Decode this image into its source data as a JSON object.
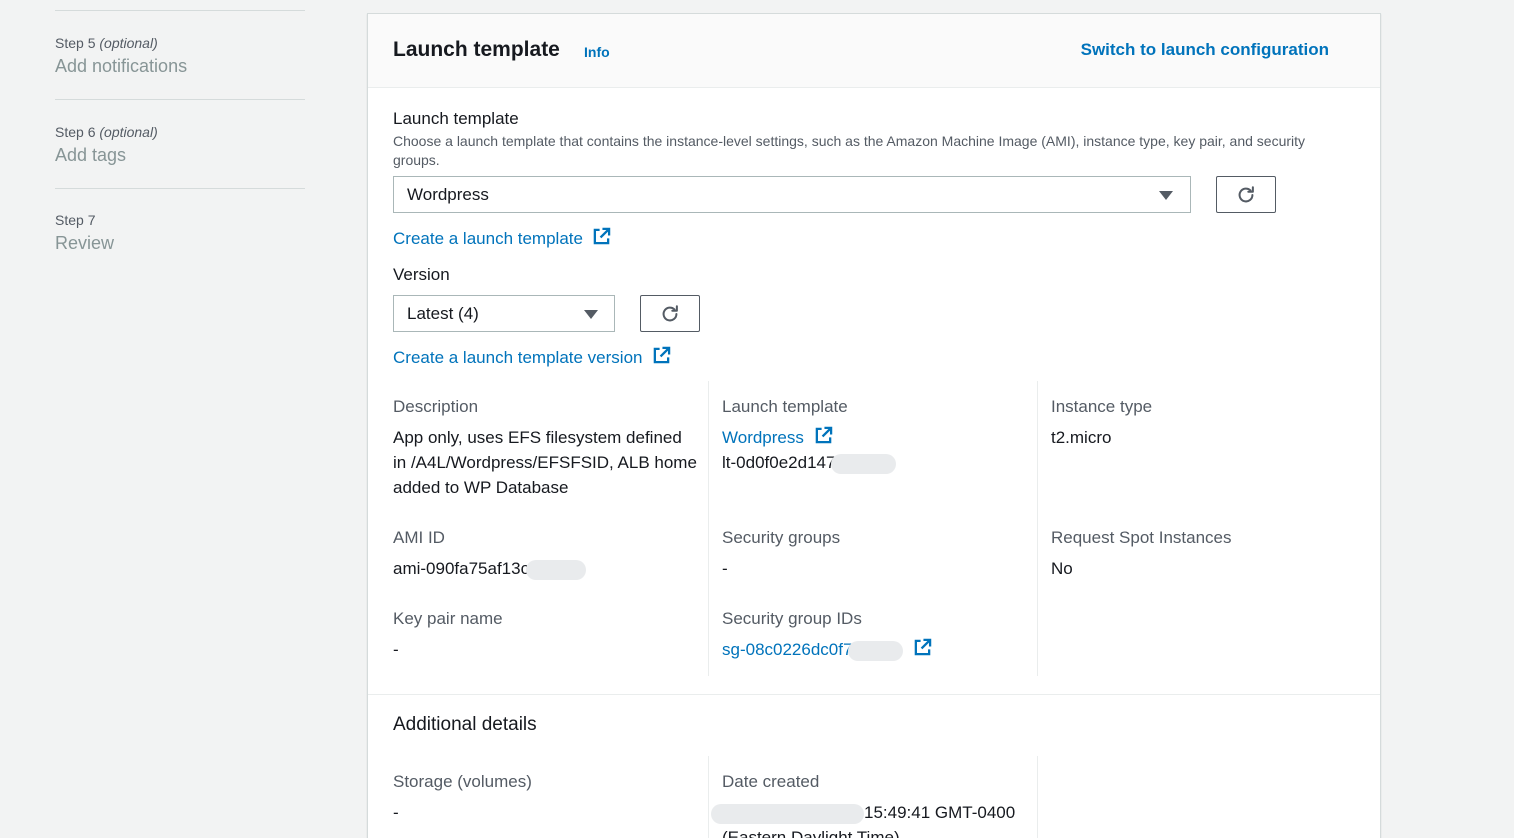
{
  "steps": [
    {
      "number": "Step 5",
      "optional": "(optional)",
      "title": "Add notifications"
    },
    {
      "number": "Step 6",
      "optional": "(optional)",
      "title": "Add tags"
    },
    {
      "number": "Step 7",
      "optional": "",
      "title": "Review"
    }
  ],
  "panel": {
    "title": "Launch template",
    "info": "Info",
    "switch_link": "Switch to launch configuration"
  },
  "template_field": {
    "label": "Launch template",
    "description": "Choose a launch template that contains the instance-level settings, such as the Amazon Machine Image (AMI), instance type, key pair, and security groups.",
    "value": "Wordpress",
    "create_link": "Create a launch template"
  },
  "version_field": {
    "label": "Version",
    "value": "Latest (4)",
    "create_link": "Create a launch template version"
  },
  "details": {
    "description": {
      "key": "Description",
      "value": "App only, uses EFS filesystem defined in /A4L/Wordpress/EFSFSID, ALB home added to WP Database"
    },
    "launch_template": {
      "key": "Launch template",
      "name": "Wordpress",
      "id": "lt-0d0f0e2d147"
    },
    "instance_type": {
      "key": "Instance type",
      "value": "t2.micro"
    },
    "ami_id": {
      "key": "AMI ID",
      "value": "ami-090fa75af13c"
    },
    "security_groups": {
      "key": "Security groups",
      "value": "-"
    },
    "spot": {
      "key": "Request Spot Instances",
      "value": "No"
    },
    "key_pair": {
      "key": "Key pair name",
      "value": "-"
    },
    "security_group_ids": {
      "key": "Security group IDs",
      "value": "sg-08c0226dc0f7"
    }
  },
  "additional": {
    "title": "Additional details",
    "storage": {
      "key": "Storage (volumes)",
      "value": "-"
    },
    "date_created": {
      "key": "Date created",
      "value": "15:49:41 GMT-0400",
      "tz": "(Eastern Daylight Time)"
    }
  },
  "colors": {
    "link": "#0073bb",
    "text": "#16191f",
    "muted": "#545b64",
    "background": "#f2f3f3"
  }
}
